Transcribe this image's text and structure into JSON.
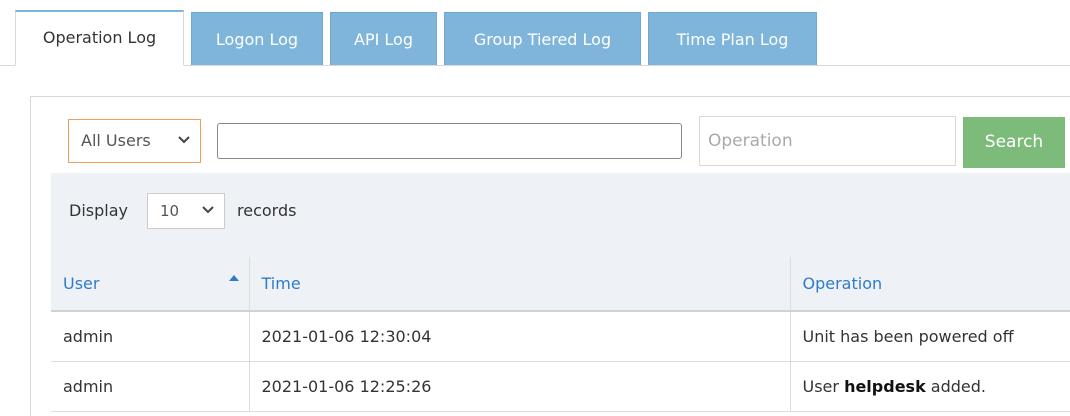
{
  "tabs": [
    {
      "label": "Operation Log",
      "active": true
    },
    {
      "label": "Logon Log",
      "active": false
    },
    {
      "label": "API Log",
      "active": false
    },
    {
      "label": "Group Tiered Log",
      "active": false
    },
    {
      "label": "Time Plan Log",
      "active": false
    }
  ],
  "filters": {
    "user_select": {
      "selected": "All Users"
    },
    "search_value": "",
    "operation_placeholder": "Operation",
    "search_label": "Search"
  },
  "display": {
    "label": "Display",
    "page_size": "10",
    "records_label": "records"
  },
  "table": {
    "headers": [
      "User",
      "Time",
      "Operation"
    ],
    "sort": {
      "column": "User",
      "direction": "ascending"
    },
    "rows": [
      {
        "user": "admin",
        "time": "2021-01-06 12:30:04",
        "operation_before": "Unit has been powered off",
        "operation_bold": "",
        "operation_after": ""
      },
      {
        "user": "admin",
        "time": "2021-01-06 12:25:26",
        "operation_before": "User ",
        "operation_bold": "helpdesk",
        "operation_after": " added."
      }
    ]
  },
  "colors": {
    "tab_inactive": "#7fb5da",
    "search_button": "#7dbb7a",
    "select_border": "#f0a05a",
    "header_text": "#2f7bc8",
    "bar_background": "#eef2f7"
  },
  "icons": {
    "dropdown": "chevron-down-icon",
    "sort": "sort-ascending-icon"
  }
}
